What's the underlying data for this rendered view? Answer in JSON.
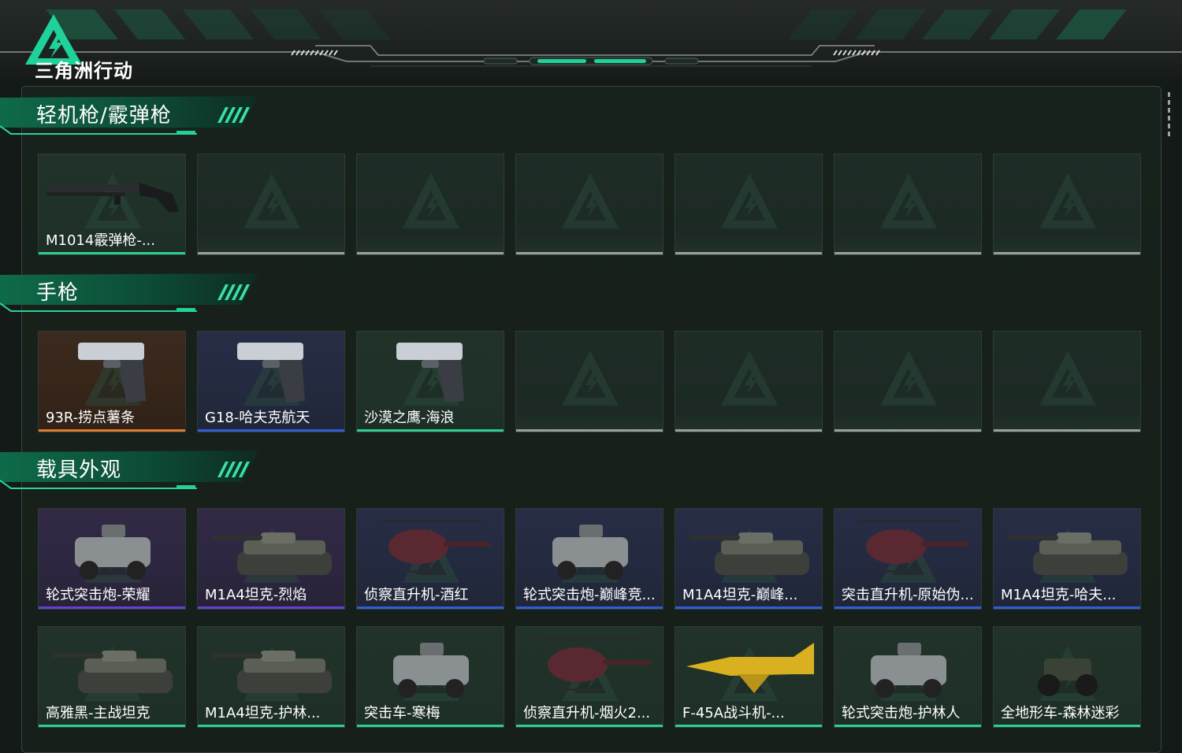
{
  "app": {
    "title": "三角洲行动"
  },
  "colors": {
    "accent": "#1fd19a",
    "green": "#2ccf8c",
    "orange": "#e07a2c",
    "blue": "#2e5fd6",
    "purple": "#6a3fd6",
    "gray": "#9aa19c"
  },
  "sections": [
    {
      "title": "轻机枪/霰弹枪",
      "items": [
        {
          "name": "M1014霰弹枪-...",
          "rarity": "green",
          "icon": "shotgun-icon"
        },
        {
          "name": "",
          "rarity": "empty"
        },
        {
          "name": "",
          "rarity": "empty"
        },
        {
          "name": "",
          "rarity": "empty"
        },
        {
          "name": "",
          "rarity": "empty"
        },
        {
          "name": "",
          "rarity": "empty"
        },
        {
          "name": "",
          "rarity": "empty"
        }
      ]
    },
    {
      "title": "手枪",
      "items": [
        {
          "name": "93R-捞点薯条",
          "rarity": "orange",
          "icon": "pistol-icon"
        },
        {
          "name": "G18-哈夫克航天",
          "rarity": "blue",
          "icon": "pistol-icon"
        },
        {
          "name": "沙漠之鹰-海浪",
          "rarity": "green",
          "icon": "pistol-icon"
        },
        {
          "name": "",
          "rarity": "empty"
        },
        {
          "name": "",
          "rarity": "empty"
        },
        {
          "name": "",
          "rarity": "empty"
        },
        {
          "name": "",
          "rarity": "empty"
        }
      ]
    },
    {
      "title": "载具外观",
      "items": [
        {
          "name": "轮式突击炮-荣耀",
          "rarity": "purple",
          "icon": "armored-car-icon"
        },
        {
          "name": "M1A4坦克-烈焰",
          "rarity": "purple",
          "icon": "tank-icon"
        },
        {
          "name": "侦察直升机-酒红",
          "rarity": "blue",
          "icon": "helicopter-icon"
        },
        {
          "name": "轮式突击炮-巅峰竞...",
          "rarity": "blue",
          "icon": "armored-car-icon"
        },
        {
          "name": "M1A4坦克-巅峰...",
          "rarity": "blue",
          "icon": "tank-icon"
        },
        {
          "name": "突击直升机-原始伪...",
          "rarity": "blue",
          "icon": "attack-helicopter-icon"
        },
        {
          "name": "M1A4坦克-哈夫...",
          "rarity": "blue",
          "icon": "tank-icon"
        },
        {
          "name": "高雅黑-主战坦克",
          "rarity": "green",
          "icon": "tank-icon"
        },
        {
          "name": "M1A4坦克-护林...",
          "rarity": "green",
          "icon": "tank-icon"
        },
        {
          "name": "突击车-寒梅",
          "rarity": "green",
          "icon": "assault-vehicle-icon"
        },
        {
          "name": "侦察直升机-烟火2...",
          "rarity": "green",
          "icon": "helicopter-icon"
        },
        {
          "name": "F-45A战斗机-...",
          "rarity": "green",
          "icon": "jet-icon"
        },
        {
          "name": "轮式突击炮-护林人",
          "rarity": "green",
          "icon": "armored-car-icon"
        },
        {
          "name": "全地形车-森林迷彩",
          "rarity": "green",
          "icon": "atv-icon"
        }
      ]
    }
  ]
}
